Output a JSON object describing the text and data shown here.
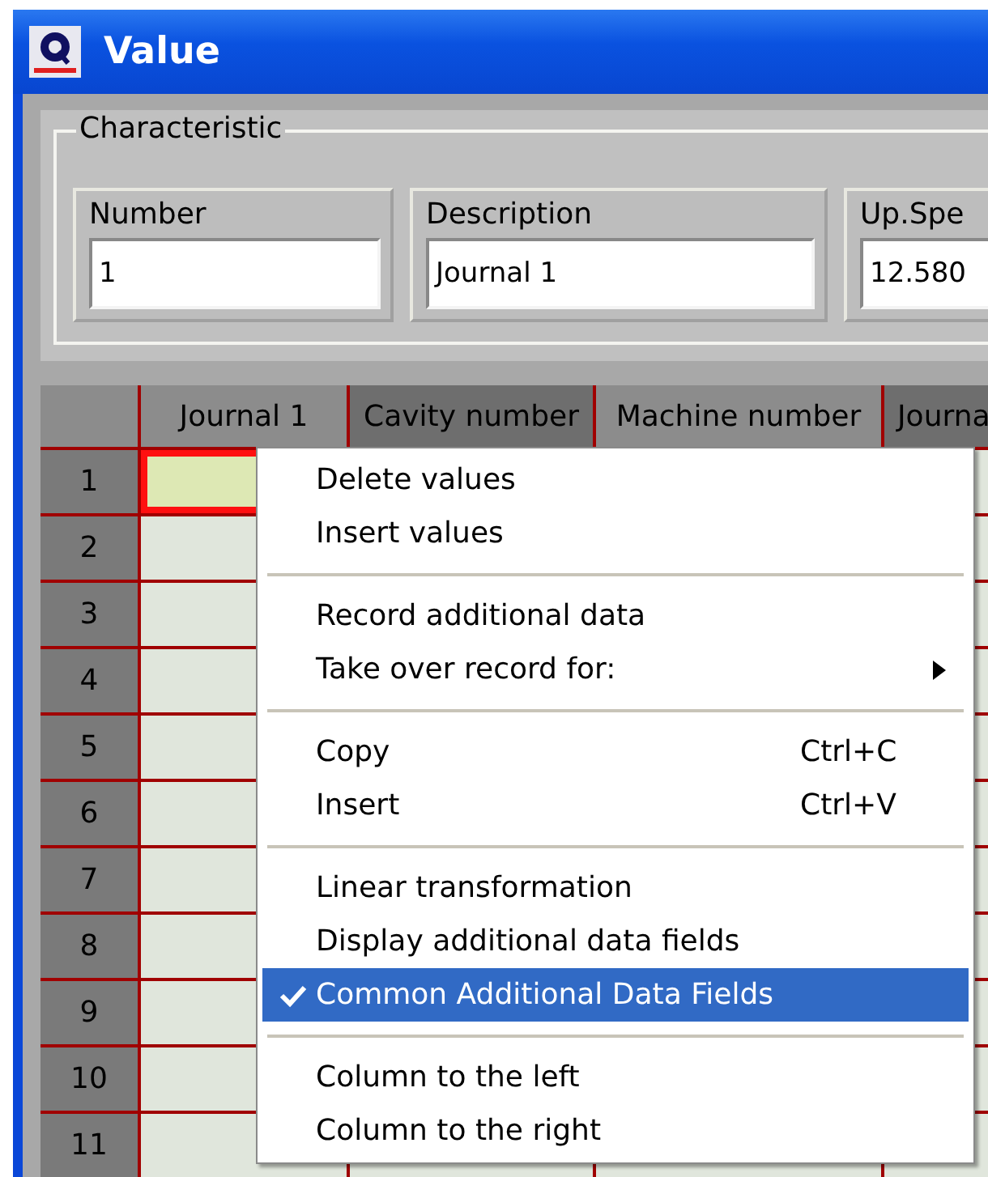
{
  "window": {
    "title": "Value"
  },
  "characteristic": {
    "title": "Characteristic",
    "fields": [
      {
        "label": "Number",
        "value": "1"
      },
      {
        "label": "Description",
        "value": "Journal 1"
      },
      {
        "label": "Up.Spe",
        "value": "12.580"
      }
    ]
  },
  "grid": {
    "columns": [
      {
        "label": "Journal 1",
        "highlighted": true
      },
      {
        "label": "Cavity number",
        "highlighted": false
      },
      {
        "label": "Machine number",
        "highlighted": true
      },
      {
        "label": "Journa",
        "highlighted": false
      }
    ],
    "rows": [
      {
        "number": "1",
        "selected": true
      },
      {
        "number": "2",
        "selected": false
      },
      {
        "number": "3",
        "selected": false
      },
      {
        "number": "4",
        "selected": false
      },
      {
        "number": "5",
        "selected": false
      },
      {
        "number": "6",
        "selected": false
      },
      {
        "number": "7",
        "selected": false
      },
      {
        "number": "8",
        "selected": false
      },
      {
        "number": "9",
        "selected": false
      },
      {
        "number": "10",
        "selected": false
      },
      {
        "number": "11",
        "selected": false
      }
    ]
  },
  "context_menu": {
    "items": [
      {
        "kind": "item",
        "label": "Delete values",
        "checked": false,
        "selected": false
      },
      {
        "kind": "item",
        "label": "Insert values",
        "checked": false,
        "selected": false
      },
      {
        "kind": "separator"
      },
      {
        "kind": "item",
        "label": "Record additional data",
        "checked": false,
        "selected": false
      },
      {
        "kind": "submenu",
        "label": "Take over record for:",
        "checked": false,
        "selected": false
      },
      {
        "kind": "separator"
      },
      {
        "kind": "item",
        "label": "Copy",
        "shortcut": "Ctrl+C",
        "checked": false,
        "selected": false
      },
      {
        "kind": "item",
        "label": "Insert",
        "shortcut": "Ctrl+V",
        "checked": false,
        "selected": false
      },
      {
        "kind": "separator"
      },
      {
        "kind": "item",
        "label": "Linear transformation",
        "checked": false,
        "selected": false
      },
      {
        "kind": "item",
        "label": "Display additional data fields",
        "checked": false,
        "selected": false
      },
      {
        "kind": "item",
        "label": "Common Additional Data Fields",
        "checked": true,
        "selected": true
      },
      {
        "kind": "separator"
      },
      {
        "kind": "item",
        "label": "Column to the left",
        "checked": false,
        "selected": false
      },
      {
        "kind": "item",
        "label": "Column to the right",
        "checked": false,
        "selected": false
      }
    ]
  }
}
